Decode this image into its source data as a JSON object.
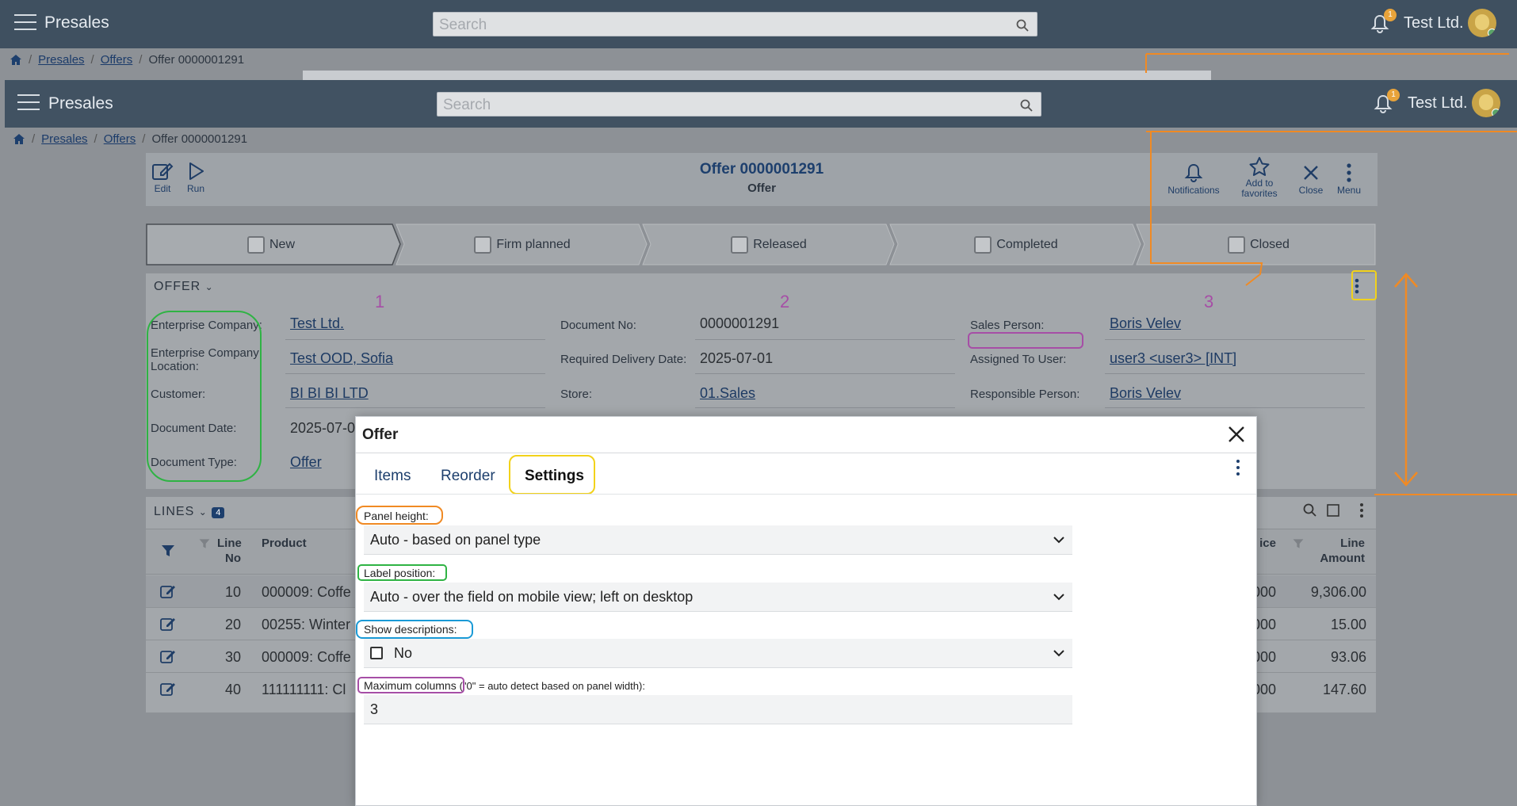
{
  "app": {
    "name": "Presales",
    "search_placeholder": "Search",
    "notification_count": "1",
    "company": "Test Ltd."
  },
  "breadcrumb": {
    "home": "home-icon",
    "items": [
      "Presales",
      "Offers"
    ],
    "current": "Offer 0000001291",
    "separator": "/"
  },
  "toolbar": {
    "edit": "Edit",
    "run": "Run",
    "title": "Offer 0000001291",
    "subtitle": "Offer",
    "notifications": "Notifications",
    "add_fav_line1": "Add to",
    "add_fav_line2": "favorites",
    "close": "Close",
    "menu": "Menu"
  },
  "steps": [
    "New",
    "Firm planned",
    "Released",
    "Completed",
    "Closed"
  ],
  "offer_section": {
    "title": "OFFER",
    "column_numbers": [
      "1",
      "2",
      "3"
    ],
    "col1": [
      {
        "label": "Enterprise Company:",
        "value": "Test Ltd."
      },
      {
        "label": "Enterprise Company Location:",
        "value": "Test OOD, Sofia"
      },
      {
        "label": "Customer:",
        "value": "BI BI BI LTD"
      },
      {
        "label": "Document Date:",
        "value": "2025-07-0"
      },
      {
        "label": "Document Type:",
        "value": "Offer"
      }
    ],
    "col2": [
      {
        "label": "Document No:",
        "value": "0000001291"
      },
      {
        "label": "Required Delivery Date:",
        "value": "2025-07-01"
      },
      {
        "label": "Store:",
        "value": "01.Sales"
      }
    ],
    "col3": [
      {
        "label": "Sales Person:",
        "value": "Boris Velev"
      },
      {
        "label": "Assigned To User:",
        "value": "user3 <user3> [INT]"
      },
      {
        "label": "Responsible Person:",
        "value": "Boris Velev"
      }
    ]
  },
  "lines": {
    "title": "LINES",
    "count": "4",
    "headers": {
      "line_no_1": "Line",
      "line_no_2": "No",
      "product": "Product",
      "price": "ice",
      "amount_1": "Line",
      "amount_2": "Amount"
    },
    "rows": [
      {
        "no": "10",
        "product": "000009: Coffe",
        "price": "000",
        "amount": "9,306.00"
      },
      {
        "no": "20",
        "product": "00255: Winter",
        "price": "000",
        "amount": "15.00"
      },
      {
        "no": "30",
        "product": "000009: Coffe",
        "price": "000",
        "amount": "93.06"
      },
      {
        "no": "40",
        "product": "111111111: Cl",
        "price": "000",
        "amount": "147.60"
      }
    ]
  },
  "modal": {
    "title": "Offer",
    "tabs": [
      "Items",
      "Reorder",
      "Settings"
    ],
    "active_tab": "Settings",
    "panel_height_label": "Panel height:",
    "panel_height_value": "Auto - based on panel type",
    "label_position_label": "Label position:",
    "label_position_value": "Auto - over the field on mobile view; left on desktop",
    "show_descriptions_label": "Show descriptions:",
    "show_descriptions_value": "No",
    "max_columns_label": "Maximum columns",
    "max_columns_hint": "(\"0\" = auto detect based on panel width):",
    "max_columns_value": "3"
  },
  "colors": {
    "header_bg": "#415262",
    "link": "#1d3a63",
    "annotation_green": "#2fb344",
    "annotation_orange": "#f08a24",
    "annotation_blue": "#1a9ad6",
    "annotation_purple": "#a64ea6",
    "annotation_yellow": "#f2d21a"
  }
}
